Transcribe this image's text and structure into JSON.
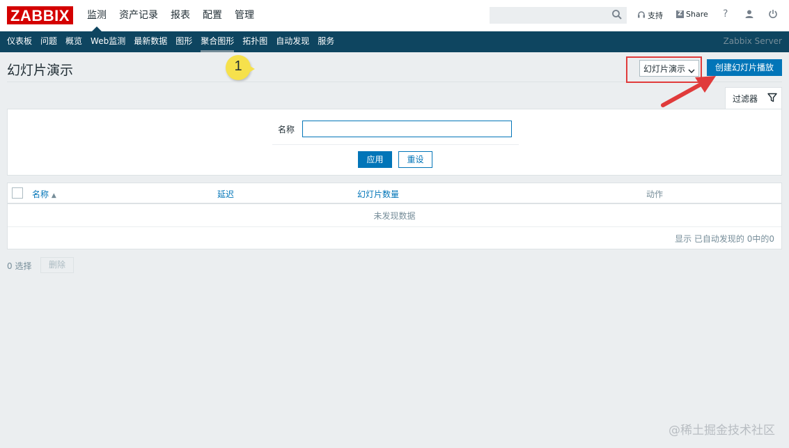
{
  "logo": {
    "text": "ZABBIX"
  },
  "top_menu": [
    {
      "label": "监测",
      "active": true
    },
    {
      "label": "资产记录"
    },
    {
      "label": "报表"
    },
    {
      "label": "配置"
    },
    {
      "label": "管理"
    }
  ],
  "top_right": {
    "search_value": "",
    "support_label": "支持",
    "share_label": "Share",
    "help_label": "?"
  },
  "sub_menu": [
    {
      "label": "仪表板"
    },
    {
      "label": "问题"
    },
    {
      "label": "概览"
    },
    {
      "label": "Web监测"
    },
    {
      "label": "最新数据"
    },
    {
      "label": "图形"
    },
    {
      "label": "聚合图形",
      "active": true
    },
    {
      "label": "拓扑图"
    },
    {
      "label": "自动发现"
    },
    {
      "label": "服务"
    }
  ],
  "server_name": "Zabbix Server",
  "page": {
    "title": "幻灯片演示",
    "annotation_number": "1",
    "view_select": "幻灯片演示",
    "create_button": "创建幻灯片播放"
  },
  "filter": {
    "tab_label": "过滤器",
    "name_label": "名称",
    "name_value": "",
    "apply_label": "应用",
    "reset_label": "重设"
  },
  "table": {
    "columns": [
      {
        "label": "名称",
        "sortable": true,
        "sort": "asc"
      },
      {
        "label": "延迟",
        "sortable": true
      },
      {
        "label": "幻灯片数量",
        "sortable": true
      },
      {
        "label": "动作",
        "sortable": false
      }
    ],
    "empty_text": "未发现数据",
    "stats": "显示 已自动发现的 0中的0"
  },
  "footer": {
    "selected_count": "0 选择",
    "delete_label": "删除"
  },
  "watermark": "@稀土掘金技术社区",
  "colors": {
    "brand_red": "#d40000",
    "nav_dark": "#0e4560",
    "primary_blue": "#0275b8",
    "annotation_yellow": "#f6e14c",
    "annotation_red": "#e03b3b"
  }
}
